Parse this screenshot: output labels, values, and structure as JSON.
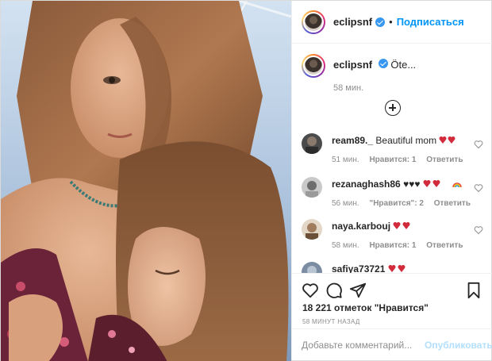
{
  "post": {
    "username": "eclipsnf",
    "follow_label": "Подписаться",
    "dot": "•",
    "caption_text": "Öte...",
    "caption_time": "58 мин.",
    "likes_count": "18 221 отметок \"Нравится\"",
    "post_time": "58 МИНУТ НАЗАД",
    "comment_placeholder": "Добавьте комментарий...",
    "publish_label": "Опубликовать"
  },
  "comments": [
    {
      "user": "ream89._",
      "text": "Beautiful mom",
      "emojis": [
        "heart-pair-icon"
      ],
      "time": "51 мин.",
      "likes": "Нравится: 1",
      "reply": "Ответить"
    },
    {
      "user": "rezanaghash86",
      "text": "♥♥♥",
      "emojis": [
        "heart-pair-icon",
        "red-heart-icon",
        "rainbow-icon"
      ],
      "time": "56 мин.",
      "likes": "\"Нравится\": 2",
      "reply": "Ответить"
    },
    {
      "user": "naya.karbouj",
      "text": "",
      "emojis": [
        "red-heart-icon",
        "red-heart-icon"
      ],
      "time": "58 мин.",
      "likes": "Нравится: 1",
      "reply": "Ответить"
    },
    {
      "user": "safiya73721",
      "text": "",
      "emojis": [
        "red-heart-icon",
        "red-heart-icon"
      ],
      "time": "",
      "likes": "",
      "reply": ""
    }
  ],
  "colors": {
    "accent": "#0095f6",
    "verified": "#3897f0",
    "muted": "#8e8e8e",
    "publish_disabled": "#b2dffc"
  }
}
